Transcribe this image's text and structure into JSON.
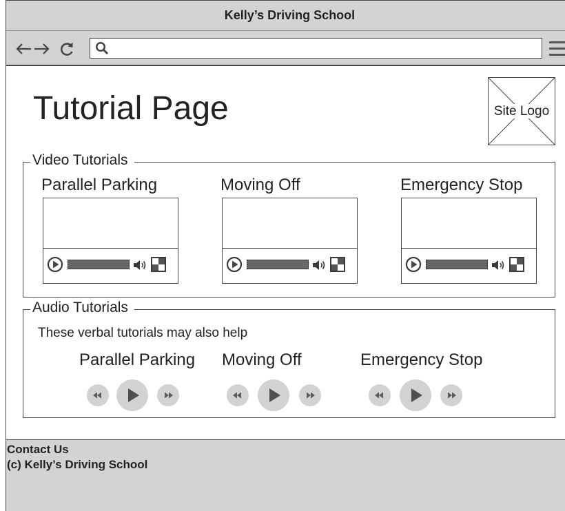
{
  "window": {
    "title": "Kelly’s Driving School"
  },
  "browser": {
    "nav_icons": [
      "arrow-left-icon",
      "arrow-right-icon",
      "reload-icon"
    ],
    "search_icon": "search-icon",
    "menu_icon": "hamburger-menu-icon",
    "address": {
      "value": ""
    }
  },
  "page": {
    "title": "Tutorial Page",
    "logo_label": "Site Logo"
  },
  "video_section": {
    "legend": "Video Tutorials",
    "videos": [
      {
        "title": "Parallel Parking"
      },
      {
        "title": "Moving Off"
      },
      {
        "title": "Emergency Stop"
      }
    ],
    "player_icons": [
      "play-icon",
      "volume-icon",
      "fullscreen-icon"
    ]
  },
  "audio_section": {
    "legend": "Audio Tutorials",
    "intro": "These verbal tutorials may also help",
    "tracks": [
      {
        "title": "Parallel Parking"
      },
      {
        "title": "Moving Off"
      },
      {
        "title": "Emergency Stop"
      }
    ],
    "player_icons": [
      "rewind-icon",
      "play-icon",
      "fast-forward-icon"
    ]
  },
  "footer": {
    "contact": "Contact Us",
    "copyright": "(c) Kelly’s Driving School"
  },
  "colors": {
    "chrome": "#d3d3d3",
    "outline": "#454545",
    "text": "#222222",
    "audio_button": "#d2d2d2",
    "audio_glyph": "#5a5a5a",
    "progress_fill": "#676767"
  }
}
